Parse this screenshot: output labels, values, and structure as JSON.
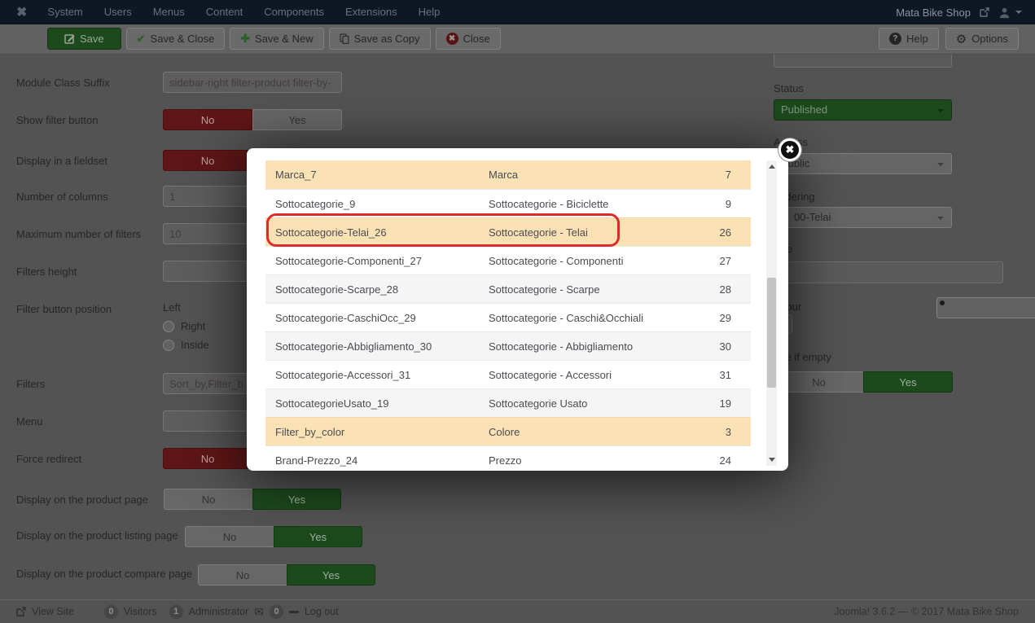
{
  "navbar": {
    "menu": [
      "System",
      "Users",
      "Menus",
      "Content",
      "Components",
      "Extensions",
      "Help"
    ],
    "brand": "Mata Bike Shop"
  },
  "toolbar": {
    "save": "Save",
    "save_close": "Save & Close",
    "save_new": "Save & New",
    "save_copy": "Save as Copy",
    "close": "Close",
    "help": "Help",
    "options": "Options"
  },
  "form": {
    "toggle_no": "No",
    "toggle_yes": "Yes",
    "module_class_suffix": {
      "label": "Module Class Suffix",
      "value": "sidebar-right filter-product filter-by-"
    },
    "show_filter_button": {
      "label": "Show filter button",
      "active": "No"
    },
    "display_fieldset": {
      "label": "Display in a fieldset",
      "active": "No"
    },
    "number_columns": {
      "label": "Number of columns",
      "value": "1"
    },
    "max_filters": {
      "label": "Maximum number of filters",
      "value": "10"
    },
    "filters_height": {
      "label": "Filters height",
      "value": ""
    },
    "filter_button_position": {
      "label": "Filter button position",
      "options": [
        "Left",
        "Right",
        "Inside"
      ],
      "selected": "Left"
    },
    "filters": {
      "label": "Filters",
      "value": "Sort_by,Filter_b"
    },
    "menu": {
      "label": "Menu",
      "value": ""
    },
    "force_redirect": {
      "label": "Force redirect",
      "active": "No"
    },
    "display_product_page": {
      "label": "Display on the product page",
      "active": "Yes"
    },
    "display_listing_page": {
      "label": "Display on the product listing page",
      "active": "Yes"
    },
    "display_compare_page": {
      "label": "Display on the product compare page",
      "active": "Yes"
    }
  },
  "sidebar": {
    "status_label": "Status",
    "status_value": "Published",
    "access_label": "Access",
    "access_value": "Public",
    "ordering_label": "Ordering",
    "ordering_value": "00-Telai",
    "note_label": "Note",
    "colour_label": "Colour",
    "hide_if_empty_label": "Hide if empty",
    "no": "No",
    "yes": "Yes"
  },
  "modal": {
    "close": "✖",
    "rows": [
      {
        "name": "Marca_7",
        "title": "Marca",
        "id": "7",
        "variant": "highlight"
      },
      {
        "name": "Sottocategorie_9",
        "title": "Sottocategorie - Biciclette",
        "id": "9",
        "variant": "plain"
      },
      {
        "name": "Sottocategorie-Telai_26",
        "title": "Sottocategorie - Telai",
        "id": "26",
        "variant": "highlight",
        "annotated": true
      },
      {
        "name": "Sottocategorie-Componenti_27",
        "title": "Sottocategorie - Componenti",
        "id": "27",
        "variant": "plain"
      },
      {
        "name": "Sottocategorie-Scarpe_28",
        "title": "Sottocategorie - Scarpe",
        "id": "28",
        "variant": "stripe"
      },
      {
        "name": "Sottocategorie-CaschiOcc_29",
        "title": "Sottocategorie - Caschi&Occhiali",
        "id": "29",
        "variant": "plain"
      },
      {
        "name": "Sottocategorie-Abbigliamento_30",
        "title": "Sottocategorie - Abbigliamento",
        "id": "30",
        "variant": "stripe"
      },
      {
        "name": "Sottocategorie-Accessori_31",
        "title": "Sottocategorie - Accessori",
        "id": "31",
        "variant": "plain"
      },
      {
        "name": "SottocategorieUsato_19",
        "title": "Sottocategorie Usato",
        "id": "19",
        "variant": "stripe"
      },
      {
        "name": "Filter_by_color",
        "title": "Colore",
        "id": "3",
        "variant": "highlight"
      },
      {
        "name": "Brand-Prezzo_24",
        "title": "Prezzo",
        "id": "24",
        "variant": "plain"
      }
    ]
  },
  "footer": {
    "view_site": "View Site",
    "visitors_count": "0",
    "visitors_label": "Visitors",
    "admin_count": "1",
    "admin_label": "Administrator",
    "mail_count": "0",
    "logout": "Log out",
    "version": "Joomla! 3.6.2  —  © 2017 Mata Bike Shop"
  },
  "colors": {
    "highlight_row": "#fbe2b5",
    "annotation_red": "#dd2a2a",
    "published_green": "#1d4a1d",
    "toggle_red": "#5e1616"
  }
}
